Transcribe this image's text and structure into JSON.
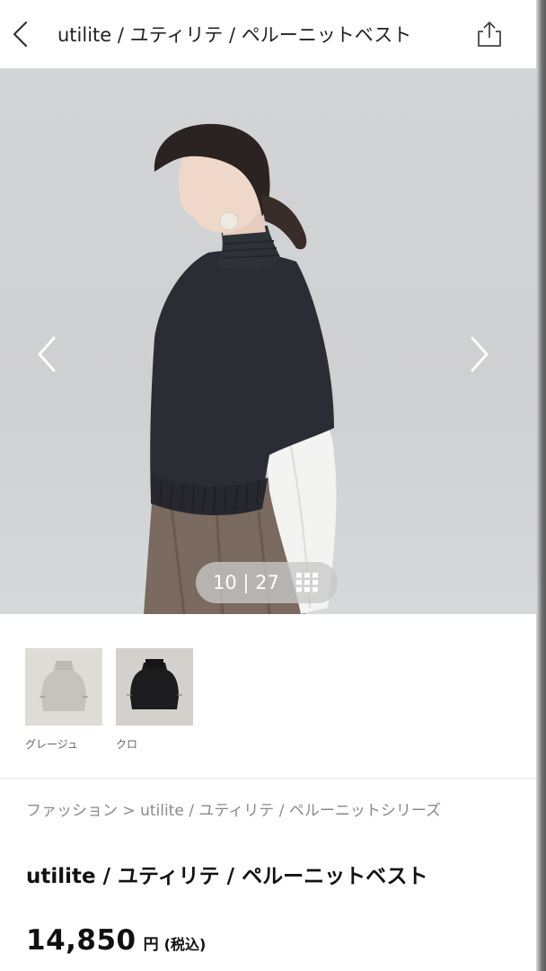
{
  "header": {
    "title": "utilite / ユティリテ / ペルーニットベスト",
    "back_icon": "chevron-left-icon",
    "share_icon": "share-icon"
  },
  "gallery": {
    "counter": "10 | 27",
    "current": 10,
    "total": 27,
    "prev_icon": "chevron-left-icon",
    "next_icon": "chevron-right-icon",
    "grid_icon": "grid-icon"
  },
  "colors": [
    {
      "label": "グレージュ",
      "swatch": "#c9c7c1"
    },
    {
      "label": "クロ",
      "swatch": "#1a1a1a"
    }
  ],
  "breadcrumb": {
    "items": [
      "ファッション",
      "utilite / ユティリテ / ペルーニットシリーズ"
    ],
    "separator": " > "
  },
  "product": {
    "title": "utilite / ユティリテ / ペルーニットベスト",
    "price": "14,850",
    "currency": "円",
    "tax_note": "(税込)"
  }
}
